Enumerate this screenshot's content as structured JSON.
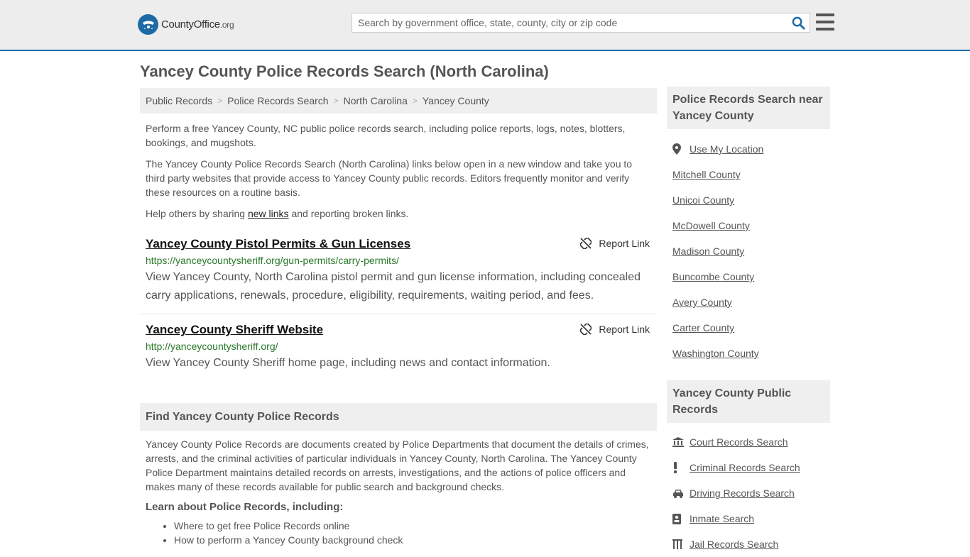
{
  "header": {
    "logo_text": "CountyOffice",
    "logo_tld": ".org",
    "search_placeholder": "Search by government office, state, county, city or zip code"
  },
  "page_title": "Yancey County Police Records Search (North Carolina)",
  "breadcrumb": [
    "Public Records",
    "Police Records Search",
    "North Carolina",
    "Yancey County"
  ],
  "intro": {
    "p1": "Perform a free Yancey County, NC public police records search, including police reports, logs, notes, blotters, bookings, and mugshots.",
    "p2": "The Yancey County Police Records Search (North Carolina) links below open in a new window and take you to third party websites that provide access to Yancey County public records. Editors frequently monitor and verify these resources on a routine basis.",
    "p3_before": "Help others by sharing ",
    "p3_link": "new links",
    "p3_after": " and reporting broken links."
  },
  "results": [
    {
      "title": "Yancey County Pistol Permits & Gun Licenses",
      "url": "https://yanceycountysheriff.org/gun-permits/carry-permits/",
      "description": "View Yancey County, North Carolina pistol permit and gun license information, including concealed carry applications, renewals, procedure, eligibility, requirements, waiting period, and fees.",
      "report_label": "Report Link"
    },
    {
      "title": "Yancey County Sheriff Website",
      "url": "http://yanceycountysheriff.org/",
      "description": "View Yancey County Sheriff home page, including news and contact information.",
      "report_label": "Report Link"
    }
  ],
  "find_section": {
    "heading": "Find Yancey County Police Records",
    "body": "Yancey County Police Records are documents created by Police Departments that document the details of crimes, arrests, and the criminal activities of particular individuals in Yancey County, North Carolina. The Yancey County Police Department maintains detailed records on arrests, investigations, and the actions of police officers and makes many of these records available for public search and background checks.",
    "learn_heading": "Learn about Police Records, including:",
    "learn_items": [
      "Where to get free Police Records online",
      "How to perform a Yancey County background check"
    ]
  },
  "sidebar": {
    "near_heading": "Police Records Search near Yancey County",
    "use_location": "Use My Location",
    "near_counties": [
      "Mitchell County",
      "Unicoi County",
      "McDowell County",
      "Madison County",
      "Buncombe County",
      "Avery County",
      "Carter County",
      "Washington County"
    ],
    "public_heading": "Yancey County Public Records",
    "public_links": [
      {
        "label": "Court Records Search",
        "icon": "courthouse-icon"
      },
      {
        "label": "Criminal Records Search",
        "icon": "exclamation-icon"
      },
      {
        "label": "Driving Records Search",
        "icon": "car-icon"
      },
      {
        "label": "Inmate Search",
        "icon": "id-card-icon"
      },
      {
        "label": "Jail Records Search",
        "icon": "jail-icon"
      }
    ]
  },
  "colors": {
    "accent": "#1e6fa8",
    "url_green": "#2a7a2a",
    "panel_gray": "#efefef"
  }
}
